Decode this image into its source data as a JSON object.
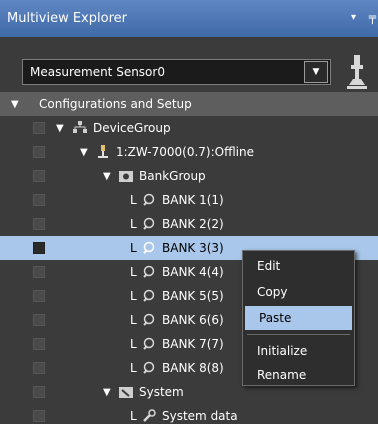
{
  "panel": {
    "title": "Multiview Explorer",
    "pin_icon": "pin-icon",
    "close_icon": "pin-icon"
  },
  "sensor": {
    "selected": "Measurement Sensor0",
    "icon": "probe-icon"
  },
  "tree": {
    "root": "Configurations and Setup",
    "device_group": "DeviceGroup",
    "device": "1:ZW-7000(0.7):Offline",
    "bank_group": "BankGroup",
    "banks": [
      "BANK 1(1)",
      "BANK 2(2)",
      "BANK 3(3)",
      "BANK 4(4)",
      "BANK 5(5)",
      "BANK 6(6)",
      "BANK 7(7)",
      "BANK 8(8)"
    ],
    "system": "System",
    "system_data": "System data",
    "selected_bank": "BANK 3(3)"
  },
  "context_menu": {
    "items": [
      "Edit",
      "Copy",
      "Paste",
      "Initialize",
      "Rename"
    ],
    "highlighted": "Paste"
  }
}
